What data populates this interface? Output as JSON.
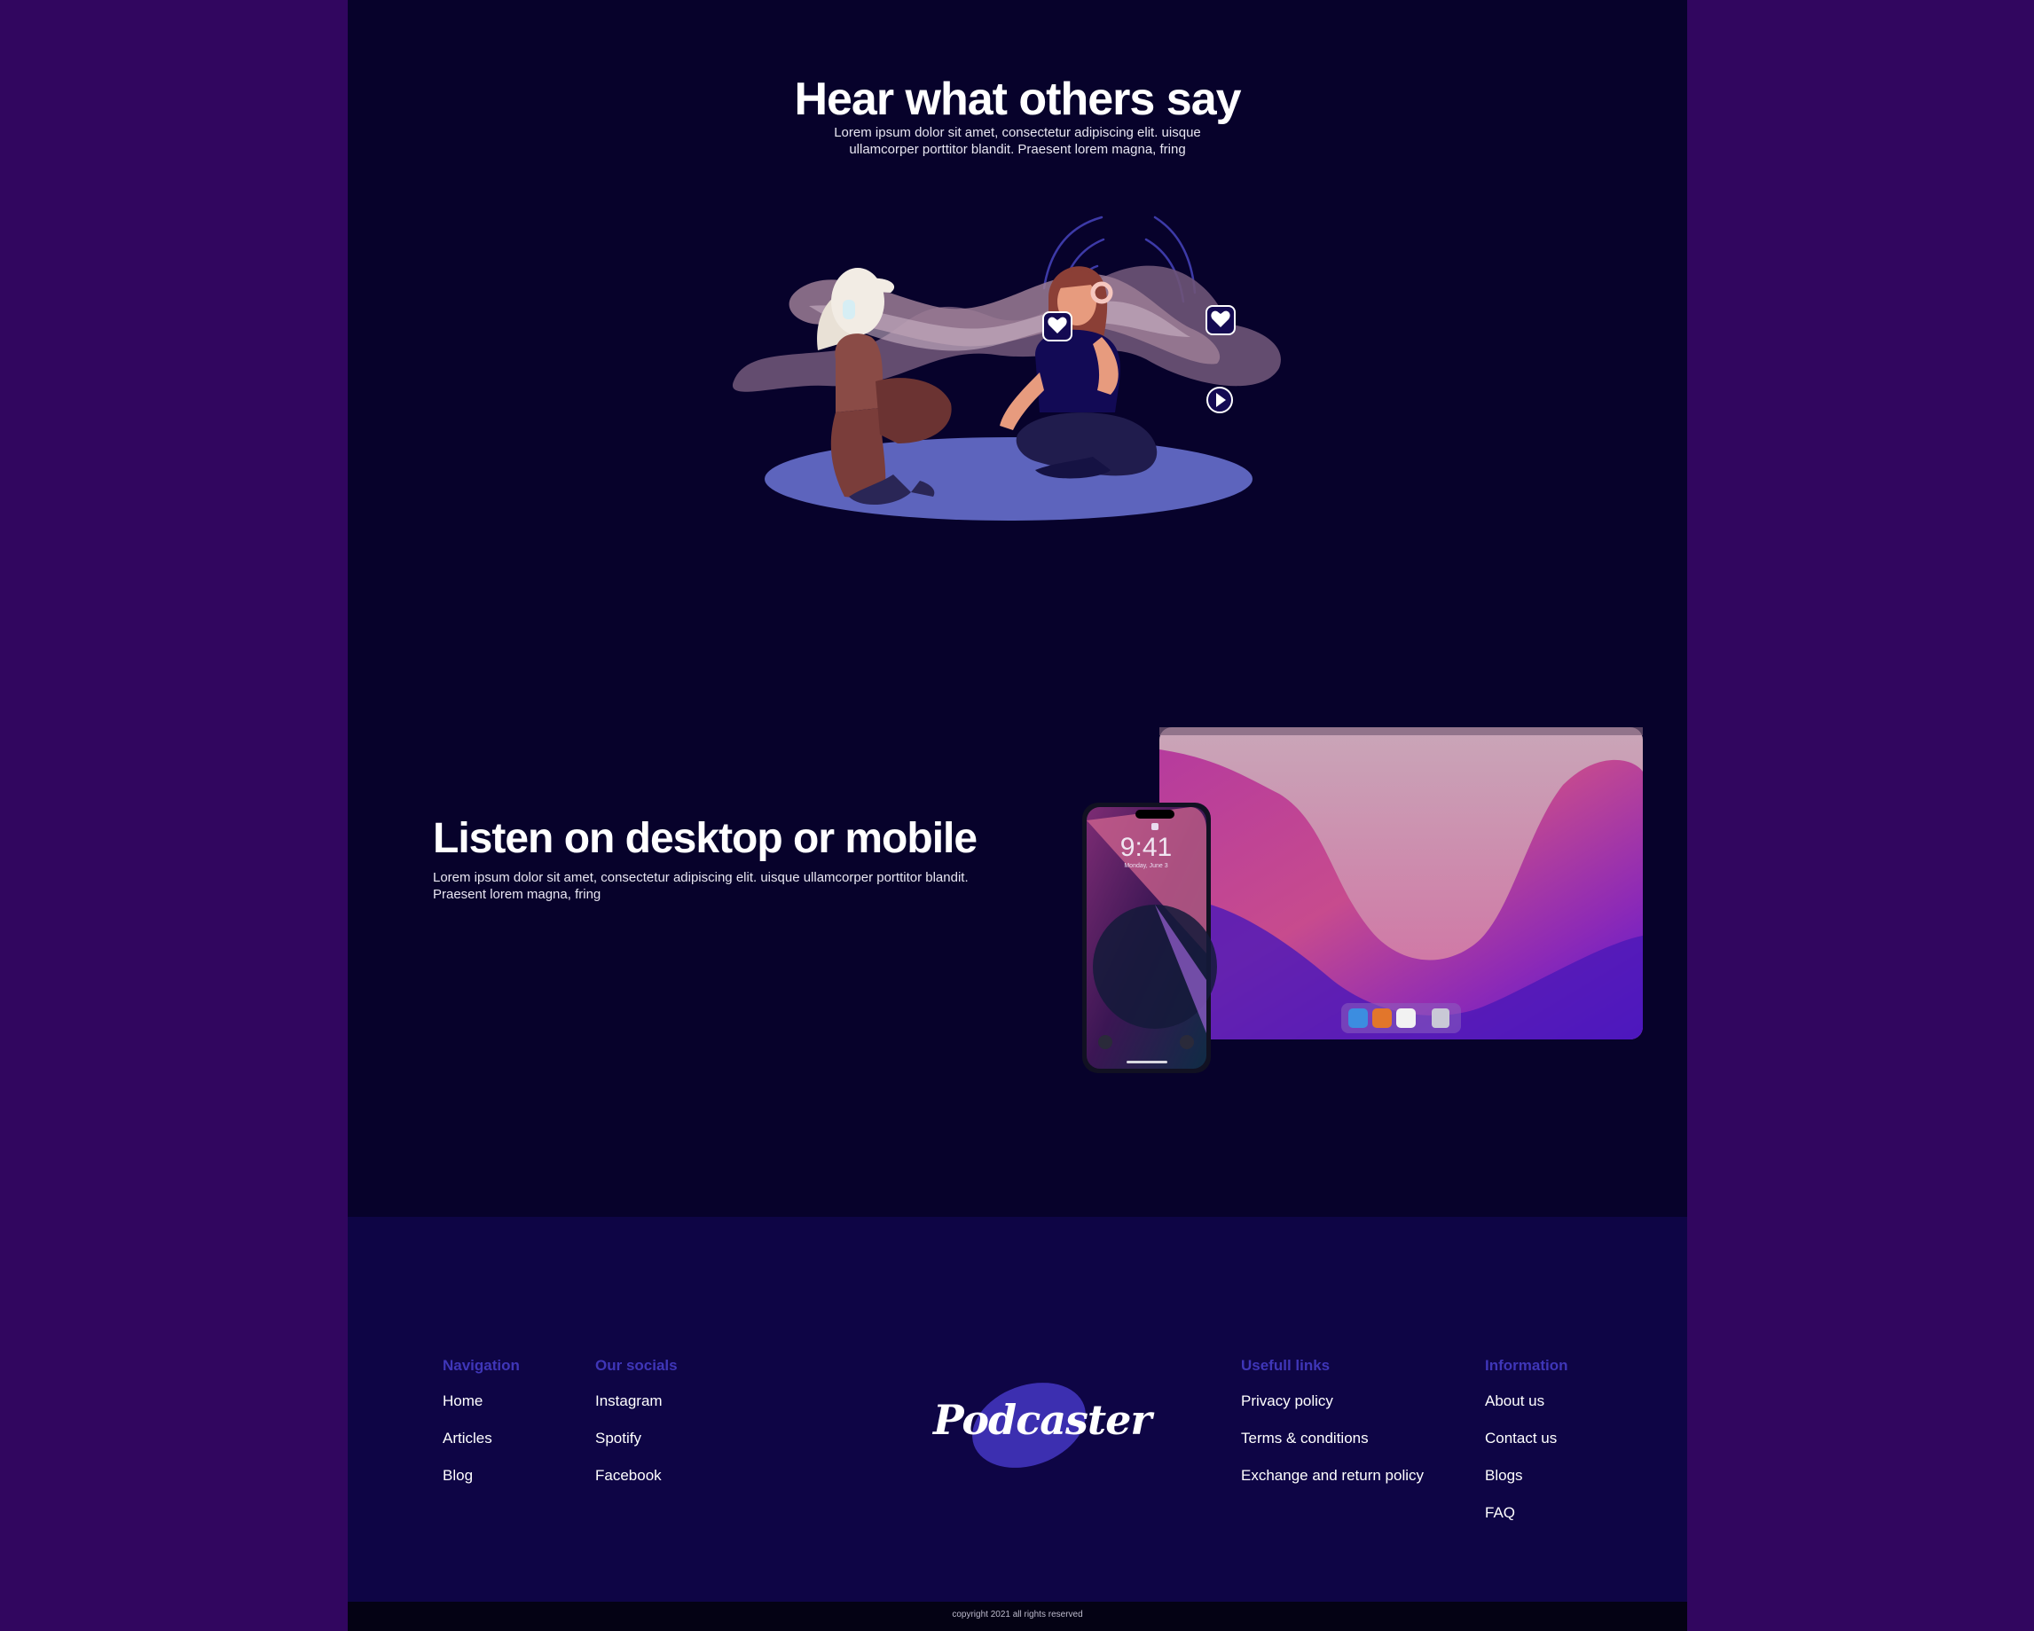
{
  "testimonials": {
    "title": "Hear what others say",
    "subtitle": "Lorem ipsum dolor sit amet, consectetur adipiscing elit. uisque ullamcorper porttitor blandit. Praesent lorem magna, fring"
  },
  "devices_section": {
    "title": "Listen on desktop or mobile",
    "subtitle": "Lorem ipsum dolor sit amet, consectetur adipiscing elit. uisque ullamcorper porttitor blandit. Praesent lorem magna, fring",
    "phone_time": "9:41",
    "phone_date": "Monday, June 3"
  },
  "footer": {
    "navigation": {
      "heading": "Navigation",
      "links": [
        "Home",
        "Articles",
        "Blog"
      ]
    },
    "socials": {
      "heading": "Our socials",
      "links": [
        "Instagram",
        "Spotify",
        "Facebook"
      ]
    },
    "logo_text": "Podcaster",
    "useful": {
      "heading": "Usefull links",
      "links": [
        "Privacy policy",
        "Terms & conditions",
        "Exchange and return policy"
      ]
    },
    "information": {
      "heading": "Information",
      "links": [
        "About us",
        "Contact us",
        "Blogs",
        "FAQ"
      ]
    },
    "copyright": "copyright 2021 all rights reserved"
  },
  "colors": {
    "outer_background": "#31065f",
    "page_background": "#07022b",
    "footer_background": "#0e0545",
    "footer_heading": "#3f36b8",
    "logo_blob": "#3c2fb0"
  },
  "icons": [
    "heart-icon",
    "play-icon",
    "lock-icon",
    "flashlight-icon",
    "camera-icon"
  ]
}
